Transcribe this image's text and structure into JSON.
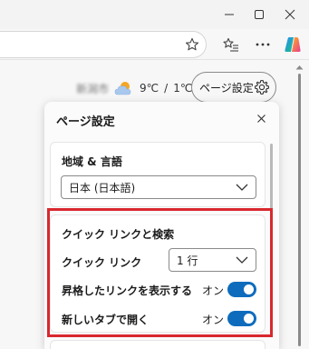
{
  "window": {
    "controls": [
      "minimize-icon",
      "maximize-icon",
      "close-icon"
    ]
  },
  "toolbar": {
    "icons": [
      "favorite-star-icon",
      "favorites-list-icon",
      "more-options-icon",
      "copilot-icon"
    ]
  },
  "newtab": {
    "location_blurred": "新潟市",
    "temp_high": "9℃",
    "separator": "/",
    "temp_low": "1℃",
    "settings_button_label": "ページ設定"
  },
  "panel": {
    "title": "ページ設定",
    "language_section": {
      "title": "地域 & 言語",
      "selected": "日本 (日本語)"
    },
    "quicklinks_section": {
      "title": "クイック リンクと検索",
      "quicklinks_label": "クイック リンク",
      "quicklinks_selected": "1 行",
      "promoted_label": "昇格したリンクを表示する",
      "promoted_state": "オン",
      "newtab_label": "新しいタブで開く",
      "newtab_state": "オン"
    }
  },
  "colors": {
    "accent": "#0f6cbd",
    "highlight": "#d9282f"
  }
}
